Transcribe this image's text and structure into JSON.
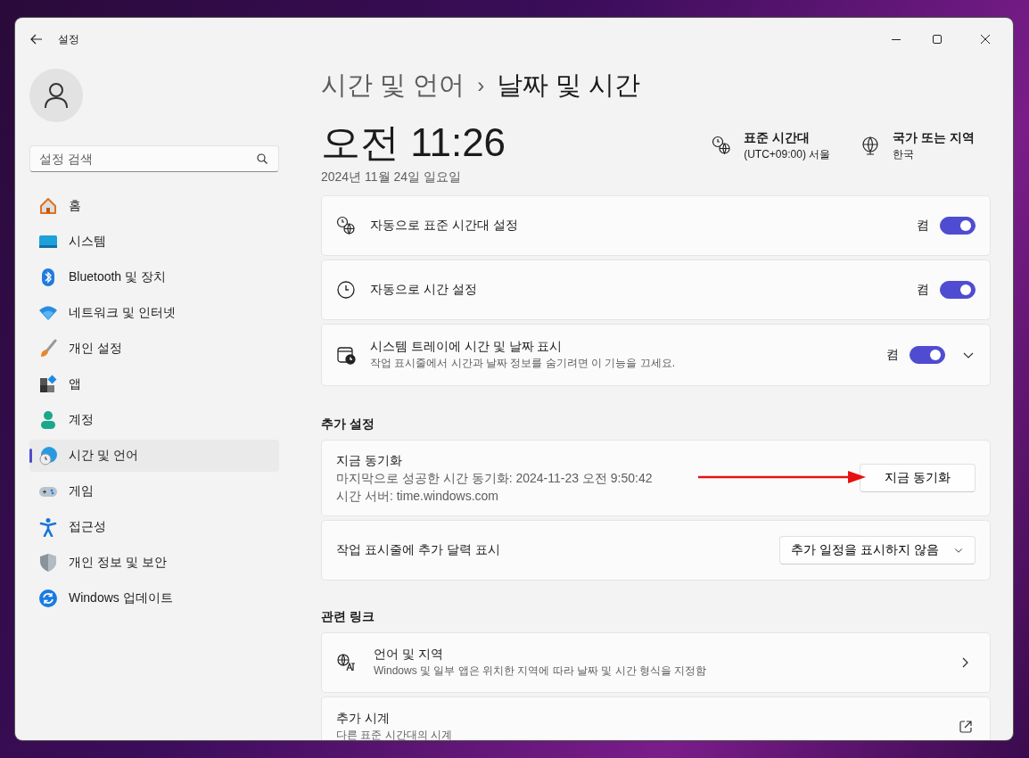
{
  "window": {
    "title": "설정"
  },
  "search": {
    "placeholder": "설정 검색"
  },
  "sidebar": {
    "items": [
      {
        "label": "홈",
        "kind": "home",
        "selected": false
      },
      {
        "label": "시스템",
        "kind": "system",
        "selected": false
      },
      {
        "label": "Bluetooth 및 장치",
        "kind": "bluetooth",
        "selected": false
      },
      {
        "label": "네트워크 및 인터넷",
        "kind": "network",
        "selected": false
      },
      {
        "label": "개인 설정",
        "kind": "brush",
        "selected": false
      },
      {
        "label": "앱",
        "kind": "apps",
        "selected": false
      },
      {
        "label": "계정",
        "kind": "account",
        "selected": false
      },
      {
        "label": "시간 및 언어",
        "kind": "time",
        "selected": true
      },
      {
        "label": "게임",
        "kind": "game",
        "selected": false
      },
      {
        "label": "접근성",
        "kind": "accessibility",
        "selected": false
      },
      {
        "label": "개인 정보 및 보안",
        "kind": "shield",
        "selected": false
      },
      {
        "label": "Windows 업데이트",
        "kind": "update",
        "selected": false
      }
    ]
  },
  "breadcrumb": {
    "parent": "시간 및 언어",
    "separator": "›",
    "current": "날짜 및 시간"
  },
  "clock": {
    "time": "오전 11:26",
    "date": "2024년 11월 24일 일요일"
  },
  "info": [
    {
      "kind": "timezone",
      "title": "표준 시간대",
      "value": "(UTC+09:00) 서울"
    },
    {
      "kind": "region",
      "title": "국가 또는 지역",
      "value": "한국"
    }
  ],
  "settings": [
    {
      "kind": "timezone",
      "label": "자동으로 표준 시간대 설정",
      "state_label": "켬",
      "on": true
    },
    {
      "kind": "clock",
      "label": "자동으로 시간 설정",
      "state_label": "켬",
      "on": true
    },
    {
      "kind": "tray",
      "label": "시스템 트레이에 시간 및 날짜 표시",
      "description": "작업 표시줄에서 시간과 날짜 정보를 숨기려면 이 기능을 끄세요.",
      "state_label": "켬",
      "on": true,
      "expanded": false
    }
  ],
  "additional": {
    "heading": "추가 설정",
    "sync": {
      "title": "지금 동기화",
      "last_sync": "마지막으로 성공한 시간 동기화: 2024-11-23 오전 9:50:42",
      "server": "시간 서버: time.windows.com",
      "button": "지금 동기화"
    },
    "calendar": {
      "label": "작업 표시줄에 추가 달력 표시",
      "value": "추가 일정을 표시하지 않음"
    }
  },
  "related": {
    "heading": "관련 링크",
    "links": [
      {
        "kind": "chevron",
        "title": "언어 및 지역",
        "description": "Windows 및 일부 앱은 위치한 지역에 따라 날짜 및 시간 형식을 지정함"
      },
      {
        "kind": "external",
        "title": "추가 시계",
        "description": "다른 표준 시간대의 시계"
      }
    ]
  }
}
